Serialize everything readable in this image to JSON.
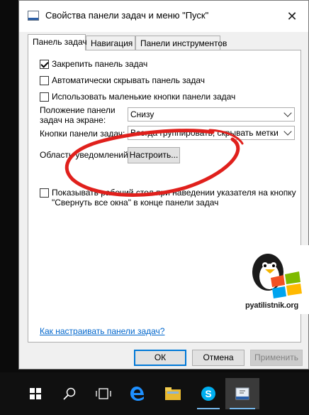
{
  "window": {
    "title": "Свойства панели задач и меню \"Пуск\""
  },
  "tabs": [
    {
      "label": "Панель задач"
    },
    {
      "label": "Навигация"
    },
    {
      "label": "Панели инструментов"
    }
  ],
  "options": {
    "lock_taskbar": {
      "label": "Закрепить панель задач",
      "checked": true
    },
    "auto_hide": {
      "label": "Автоматически скрывать панель задач",
      "checked": false
    },
    "small_buttons": {
      "label": "Использовать маленькие кнопки панели задач",
      "checked": false
    }
  },
  "position": {
    "label_line1": "Положение панели",
    "label_line2": "задач на экране:",
    "value": "Снизу"
  },
  "buttons_group": {
    "label": "Кнопки панели задач:",
    "value": "Всегда группировать, скрывать метки"
  },
  "notification": {
    "label": "Область уведомлений:",
    "button": "Настроить..."
  },
  "peek": {
    "label_line1": "Показывать рабочий стол при наведении указателя на кнопку",
    "label_line2": "\"Свернуть все окна\" в конце панели задач",
    "checked": false
  },
  "help_link": "Как настраивать панели задач?",
  "footer": {
    "ok": "ОК",
    "cancel": "Отмена",
    "apply": "Применить"
  },
  "watermark": {
    "text": "pyatilistnik.org"
  },
  "taskbar": {
    "items": [
      "start-icon",
      "search-icon",
      "task-view-icon",
      "edge-icon",
      "file-explorer-icon",
      "skype-icon",
      "taskbar-properties-icon"
    ]
  },
  "colors": {
    "accent": "#0078d7",
    "annotation": "#e0201c",
    "link": "#0066cc"
  }
}
